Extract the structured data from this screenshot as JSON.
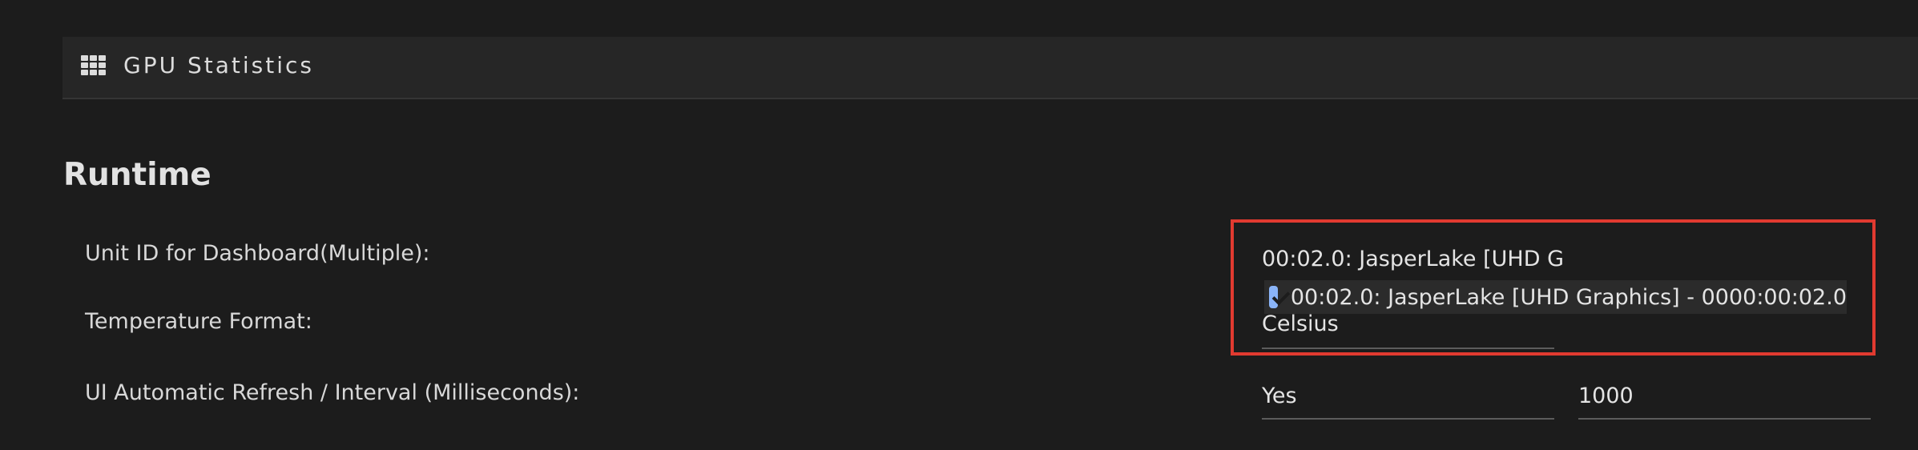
{
  "header": {
    "title": "GPU Statistics",
    "icon": "grid-icon"
  },
  "section": {
    "title": "Runtime"
  },
  "settings": {
    "unit_id": {
      "label": "Unit ID for Dashboard(Multiple):",
      "value": "00:02.0: JasperLake [UHD G",
      "options": [
        {
          "label": "00:02.0: JasperLake [UHD Graphics] - 0000:00:02.0",
          "checked": true
        }
      ]
    },
    "temperature": {
      "label": "Temperature Format:",
      "value": "Celsius"
    },
    "refresh": {
      "label": "UI Automatic Refresh / Interval (Milliseconds):",
      "enabled_value": "Yes",
      "interval_value": "1000"
    }
  },
  "colors": {
    "highlight": "#e13a30",
    "checkbox": "#8ab4f8",
    "background": "#1c1c1c"
  }
}
